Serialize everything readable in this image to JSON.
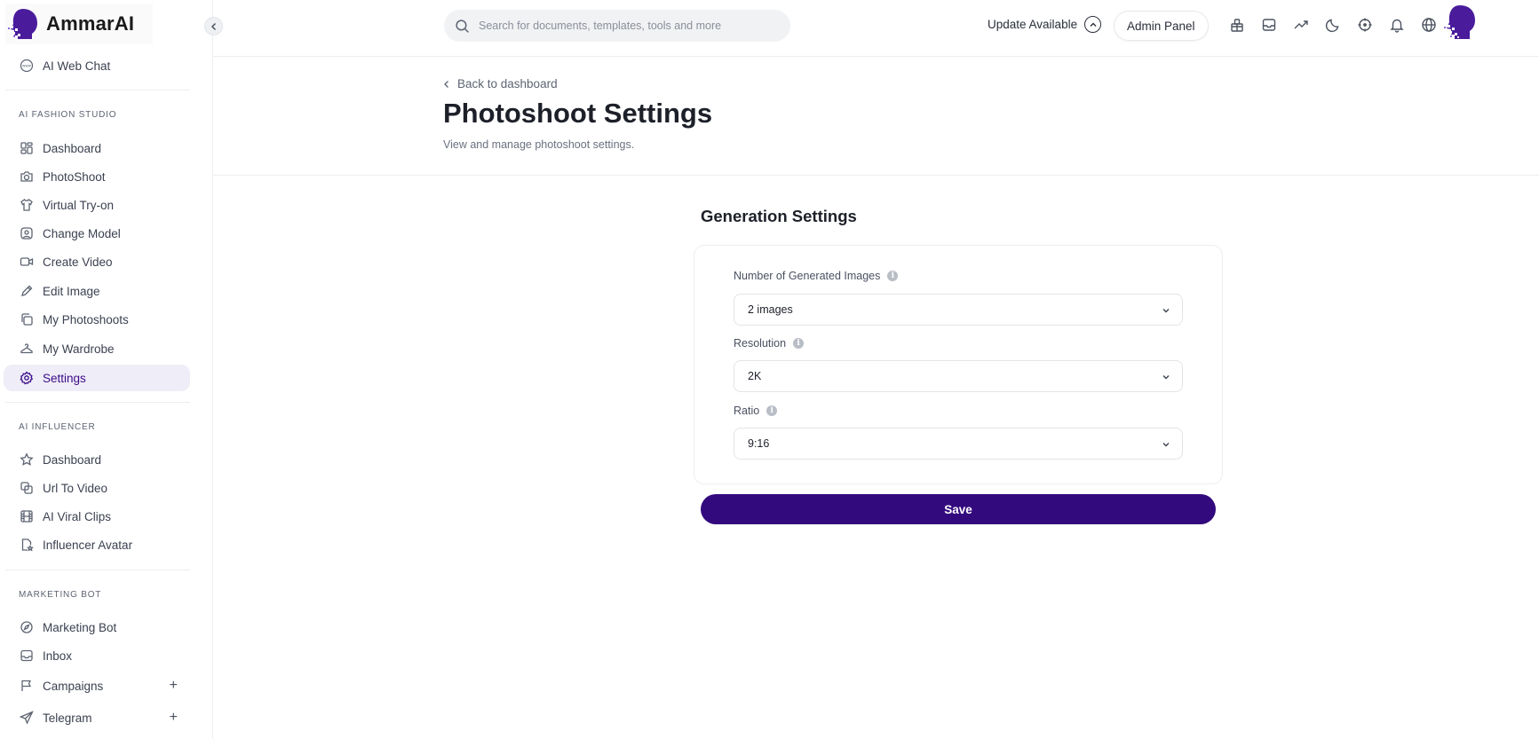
{
  "brand": {
    "name": "AmmarAI"
  },
  "search": {
    "placeholder": "Search for documents, templates, tools and more"
  },
  "topbar": {
    "update_label": "Update Available",
    "admin_label": "Admin Panel",
    "icons": [
      "gift-icon",
      "inbox-icon",
      "trending-icon",
      "moon-icon",
      "crosshair-icon",
      "bell-icon",
      "globe-icon"
    ]
  },
  "sidebar": {
    "top_item": {
      "label": "AI Web Chat",
      "icon": "www-globe-icon"
    },
    "sections": [
      {
        "title": "AI FASHION STUDIO",
        "items": [
          {
            "label": "Dashboard",
            "icon": "grid-icon"
          },
          {
            "label": "PhotoShoot",
            "icon": "camera-icon"
          },
          {
            "label": "Virtual Try-on",
            "icon": "shirt-icon"
          },
          {
            "label": "Change Model",
            "icon": "user-square-icon"
          },
          {
            "label": "Create Video",
            "icon": "video-icon"
          },
          {
            "label": "Edit Image",
            "icon": "pencil-icon"
          },
          {
            "label": "My Photoshoots",
            "icon": "copy-icon"
          },
          {
            "label": "My Wardrobe",
            "icon": "hanger-icon"
          },
          {
            "label": "Settings",
            "icon": "gear-icon",
            "active": true
          }
        ]
      },
      {
        "title": "AI INFLUENCER",
        "items": [
          {
            "label": "Dashboard",
            "icon": "star-icon"
          },
          {
            "label": "Url To Video",
            "icon": "link-video-icon"
          },
          {
            "label": "AI Viral Clips",
            "icon": "film-icon"
          },
          {
            "label": "Influencer Avatar",
            "icon": "file-star-icon"
          }
        ]
      },
      {
        "title": "MARKETING BOT",
        "items": [
          {
            "label": "Marketing Bot",
            "icon": "compass-icon"
          },
          {
            "label": "Inbox",
            "icon": "inbox-icon"
          },
          {
            "label": "Campaigns",
            "icon": "flag-icon",
            "expandable": true
          },
          {
            "label": "Telegram",
            "icon": "send-icon",
            "expandable": true
          }
        ]
      }
    ],
    "expand_glyph": "+"
  },
  "page": {
    "back_label": "Back to dashboard",
    "title": "Photoshoot Settings",
    "subtitle": "View and manage photoshoot settings."
  },
  "generation": {
    "title": "Generation Settings",
    "fields": [
      {
        "label": "Number of Generated Images",
        "value": "2 images"
      },
      {
        "label": "Resolution",
        "value": "2K"
      },
      {
        "label": "Ratio",
        "value": "9:16"
      }
    ],
    "info_glyph": "i",
    "save_label": "Save"
  },
  "colors": {
    "accent": "#330a7e",
    "active_bg": "#efedf7",
    "logo_purple": "#4a1c9c"
  }
}
